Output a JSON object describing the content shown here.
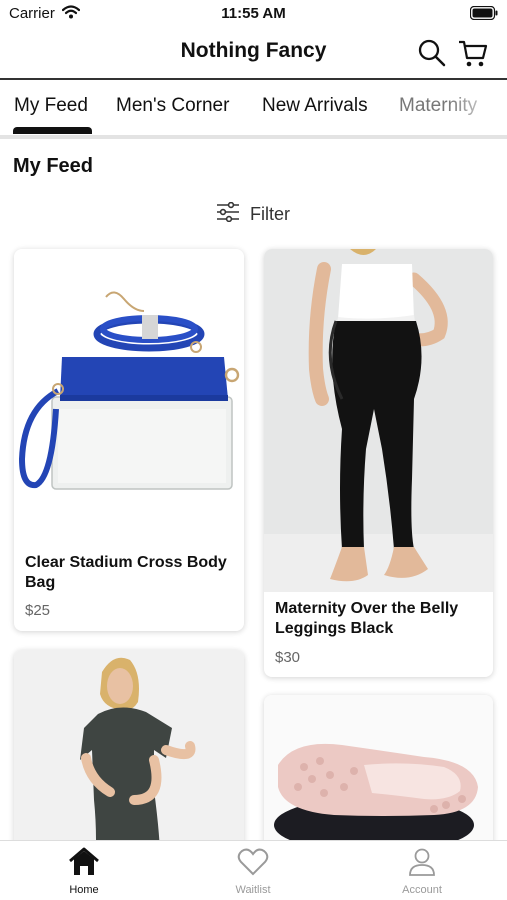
{
  "status_bar": {
    "carrier": "Carrier",
    "time": "11:55 AM"
  },
  "header": {
    "title": "Nothing Fancy"
  },
  "tabs": [
    {
      "label": "My Feed",
      "selected": true
    },
    {
      "label": "Men's Corner",
      "selected": false
    },
    {
      "label": "New Arrivals",
      "selected": false
    },
    {
      "label": "Maternity",
      "selected": false
    }
  ],
  "section": {
    "title": "My Feed"
  },
  "filter": {
    "label": "Filter"
  },
  "products": [
    {
      "name": "Clear Stadium Cross Body Bag",
      "price": "$25"
    },
    {
      "name": "Maternity Over the Belly Leggings Black",
      "price": "$30"
    },
    {
      "name": "",
      "price": ""
    },
    {
      "name": "",
      "price": ""
    }
  ],
  "bottom_nav": [
    {
      "label": "Home",
      "icon": "home-icon",
      "active": true
    },
    {
      "label": "Waitlist",
      "icon": "heart-icon",
      "active": false
    },
    {
      "label": "Account",
      "icon": "user-icon",
      "active": false
    }
  ],
  "colors": {
    "active": "#111111",
    "inactive": "#9a9a9a",
    "bag_blue": "#2345b5"
  }
}
